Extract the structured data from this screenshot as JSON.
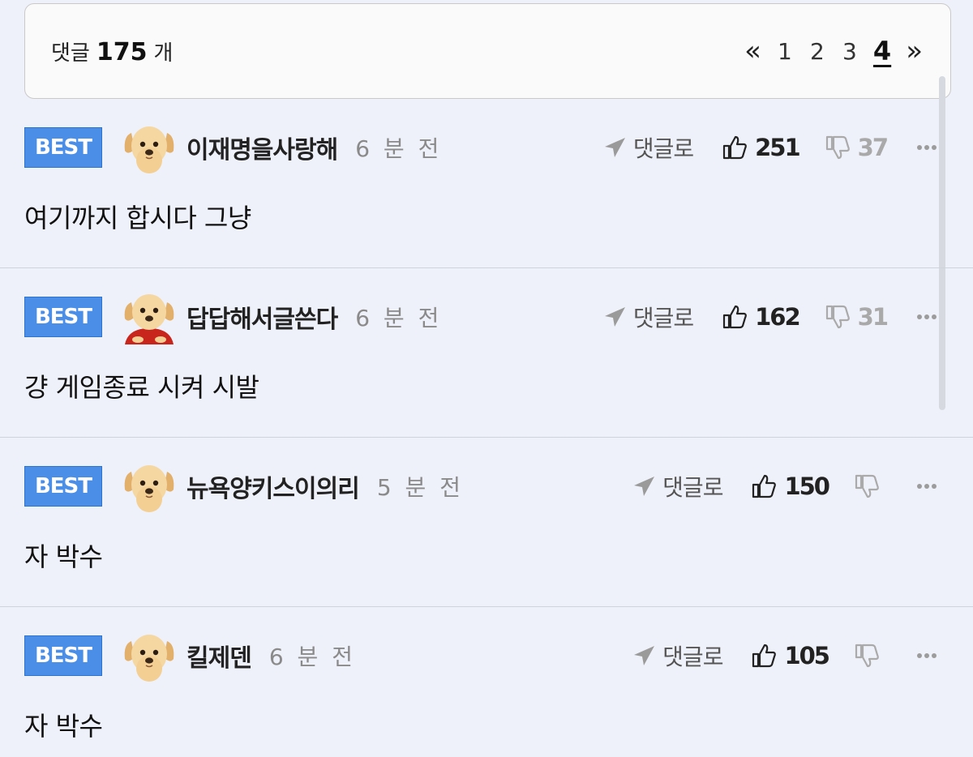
{
  "header": {
    "count_prefix": "댓글",
    "count": "175",
    "count_suffix": "개",
    "pager": {
      "first": "«",
      "pages": [
        "1",
        "2",
        "3",
        "4"
      ],
      "current": "4",
      "last": "»"
    }
  },
  "comments": [
    {
      "badge": "BEST",
      "nick": "이재명을사랑해",
      "time": "6 분 전",
      "reply_label": "댓글로",
      "likes": "251",
      "dislikes": "37",
      "text": "여기까지 합시다 그냥",
      "avatar": "puppy-icon"
    },
    {
      "badge": "BEST",
      "nick": "답답해서글쓴다",
      "time": "6 분 전",
      "reply_label": "댓글로",
      "likes": "162",
      "dislikes": "31",
      "text": "걍 게임종료 시켜 시발",
      "avatar": "puppy-cape-icon"
    },
    {
      "badge": "BEST",
      "nick": "뉴욕양키스이의리",
      "time": "5 분 전",
      "reply_label": "댓글로",
      "likes": "150",
      "dislikes": "",
      "text": "자 박수",
      "avatar": "puppy-icon"
    },
    {
      "badge": "BEST",
      "nick": "킬제덴",
      "time": "6 분 전",
      "reply_label": "댓글로",
      "likes": "105",
      "dislikes": "",
      "text": "자 박수",
      "avatar": "puppy-icon"
    }
  ],
  "colors": {
    "best_badge": "#4a8ee8",
    "background": "#eef1f9"
  }
}
